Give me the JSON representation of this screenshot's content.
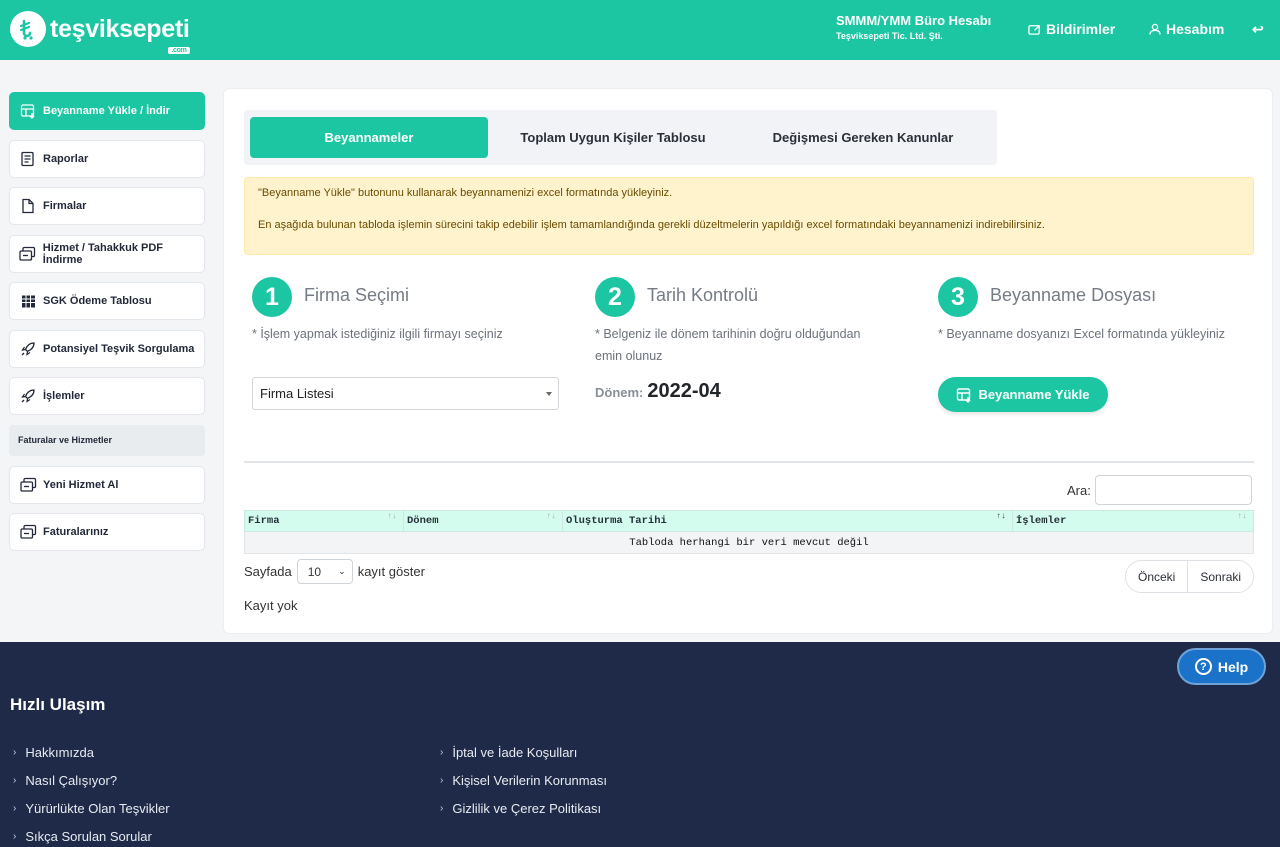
{
  "header": {
    "brand": "teşviksepeti",
    "brand_suffix": ".com",
    "account_name": "SMMM/YMM Büro Hesabı",
    "account_company": "Teşviksepeti Tic. Ltd. Şti.",
    "notifications_label": "Bildirimler",
    "account_label": "Hesabım",
    "logout_glyph": "↩"
  },
  "sidebar": {
    "items": [
      {
        "label": "Beyanname Yükle / İndir",
        "icon": "table-upload-icon",
        "active": true
      },
      {
        "label": "Raporlar",
        "icon": "report-icon"
      },
      {
        "label": "Firmalar",
        "icon": "file-icon"
      },
      {
        "label": "Hizmet / Tahakkuk PDF İndirme",
        "icon": "screen-pdf-icon"
      },
      {
        "label": "SGK Ödeme Tablosu",
        "icon": "grid-icon"
      },
      {
        "label": "Potansiyel Teşvik Sorgulama",
        "icon": "rocket-icon"
      },
      {
        "label": "İşlemler",
        "icon": "rocket-icon"
      }
    ],
    "section_title": "Faturalar ve Hizmetler",
    "section_items": [
      {
        "label": "Yeni Hizmet Al",
        "icon": "screen-pdf-icon"
      },
      {
        "label": "Faturalarınız",
        "icon": "screen-pdf-icon"
      }
    ]
  },
  "tabs": [
    {
      "label": "Beyannameler",
      "active": true
    },
    {
      "label": "Toplam Uygun Kişiler Tablosu"
    },
    {
      "label": "Değişmesi Gereken Kanunlar"
    }
  ],
  "alert": {
    "line1": "\"Beyanname Yükle\" butonunu kullanarak beyannamenizi excel formatında yükleyiniz.",
    "line2": "En aşağıda bulunan tabloda işlemin sürecini takip edebilir işlem tamamlandığında gerekli düzeltmelerin yapıldığı excel formatındaki beyannamenizi indirebilirsiniz."
  },
  "steps": [
    {
      "number": "1",
      "title": "Firma Seçimi",
      "desc": "* İşlem yapmak istediğiniz ilgili firmayı seçiniz"
    },
    {
      "number": "2",
      "title": "Tarih Kontrolü",
      "desc": "* Belgeniz ile dönem tarihinin doğru olduğundan",
      "desc2": "emin olunuz"
    },
    {
      "number": "3",
      "title": "Beyanname Dosyası",
      "desc": "* Beyanname dosyanızı Excel formatında yükleyiniz"
    }
  ],
  "firm_select": {
    "value": "Firma Listesi"
  },
  "period": {
    "label": "Dönem:",
    "value": "2022-04"
  },
  "upload_button": {
    "label": "Beyanname Yükle"
  },
  "table": {
    "search_label": "Ara:",
    "search_value": "",
    "columns": [
      "Firma",
      "Dönem",
      "Oluşturma Tarihi",
      "İşlemler"
    ],
    "empty_message": "Tabloda herhangi bir veri mevcut değil",
    "length_prefix": "Sayfada",
    "length_value": "10",
    "length_suffix": "kayıt göster",
    "prev_label": "Önceki",
    "next_label": "Sonraki",
    "info": "Kayıt yok"
  },
  "footer": {
    "title": "Hızlı Ulaşım",
    "col1": [
      "Hakkımızda",
      "Nasıl Çalışıyor?",
      "Yürürlükte Olan Teşvikler",
      "Sıkça Sorulan Sorular"
    ],
    "col2": [
      "İptal ve İade Koşulları",
      "Kişisel Verilerin Korunması",
      "Gizlilik ve Çerez Politikası"
    ],
    "help_label": "Help"
  },
  "colors": {
    "brand": "#1cc6a2",
    "footer": "#1e2a47",
    "alert_bg": "#fff3cd",
    "help": "#1a73c9"
  }
}
